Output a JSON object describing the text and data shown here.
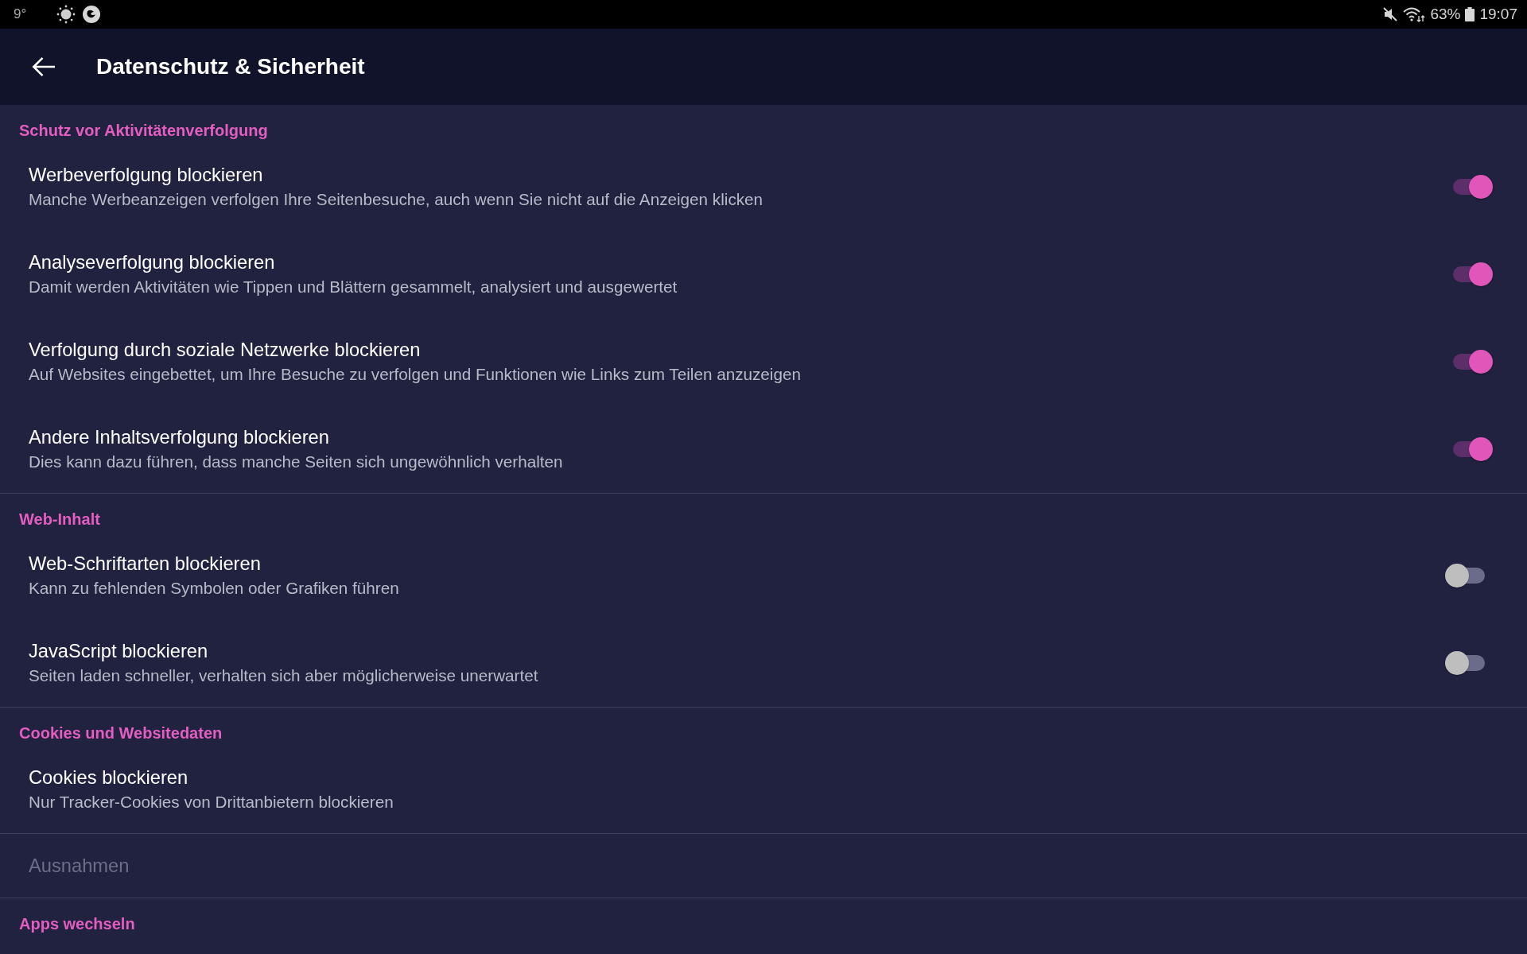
{
  "status_bar": {
    "temperature": "9°",
    "battery": "63%",
    "time": "19:07"
  },
  "app_bar": {
    "title": "Datenschutz & Sicherheit"
  },
  "sections": [
    {
      "title": "Schutz vor Aktivitätenverfolgung",
      "items": [
        {
          "kind": "switch",
          "title": "Werbeverfolgung blockieren",
          "summary": "Manche Werbeanzeigen verfolgen Ihre Seitenbesuche, auch wenn Sie nicht auf die Anzeigen klicken",
          "on": true,
          "disabled": false
        },
        {
          "kind": "switch",
          "title": "Analyseverfolgung blockieren",
          "summary": "Damit werden Aktivitäten wie Tippen und Blättern gesammelt, analysiert und ausgewertet",
          "on": true,
          "disabled": false
        },
        {
          "kind": "switch",
          "title": "Verfolgung durch soziale Netzwerke blockieren",
          "summary": "Auf Websites eingebettet, um Ihre Besuche zu verfolgen und Funktionen wie Links zum Teilen anzuzeigen",
          "on": true,
          "disabled": false
        },
        {
          "kind": "switch",
          "title": "Andere Inhaltsverfolgung blockieren",
          "summary": "Dies kann dazu führen, dass manche Seiten sich ungewöhnlich verhalten",
          "on": true,
          "disabled": false
        }
      ]
    },
    {
      "title": "Web-Inhalt",
      "items": [
        {
          "kind": "switch",
          "title": "Web-Schriftarten blockieren",
          "summary": "Kann zu fehlenden Symbolen oder Grafiken führen",
          "on": false,
          "disabled": false
        },
        {
          "kind": "switch",
          "title": "JavaScript blockieren",
          "summary": "Seiten laden schneller, verhalten sich aber möglicherweise unerwartet",
          "on": false,
          "disabled": false
        }
      ]
    },
    {
      "title": "Cookies und Websitedaten",
      "items": [
        {
          "kind": "text",
          "title": "Cookies blockieren",
          "summary": "Nur Tracker-Cookies von Drittanbietern blockieren",
          "disabled": false
        }
      ]
    },
    {
      "items": [
        {
          "kind": "text",
          "title": "Ausnahmen",
          "disabled": true
        }
      ]
    },
    {
      "title": "Apps wechseln"
    }
  ]
}
